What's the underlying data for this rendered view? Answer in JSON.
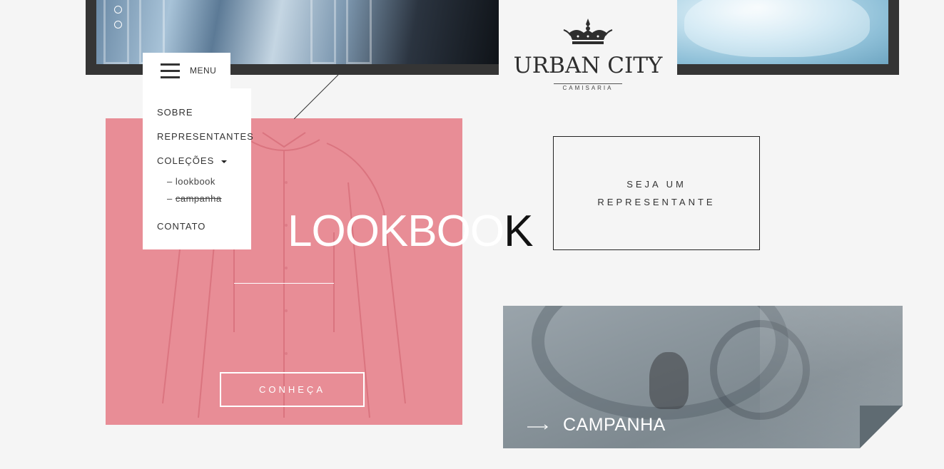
{
  "brand": {
    "name": "URBAN CITY",
    "subtitle": "CAMISARIA"
  },
  "menu": {
    "toggle_label": "MENU",
    "items": [
      {
        "label": "SOBRE"
      },
      {
        "label": "REPRESENTANTES"
      },
      {
        "label": "COLEÇÕES"
      },
      {
        "label": "CONTATO"
      }
    ],
    "submenu": [
      {
        "label": "lookbook"
      },
      {
        "label": "campanha"
      }
    ],
    "submenu_prefix": "–"
  },
  "lookbook": {
    "title_main": "LOOKBOO",
    "title_last": "K",
    "button_label": "CONHEÇA",
    "accent": "#e88d96"
  },
  "representative": {
    "line1": "SEJA UM",
    "line2": "REPRESENTANTE"
  },
  "campaign": {
    "label": "CAMPANHA"
  },
  "colors": {
    "background": "#f5f5f5",
    "frame": "#353535",
    "fold": "#5f6b72"
  }
}
